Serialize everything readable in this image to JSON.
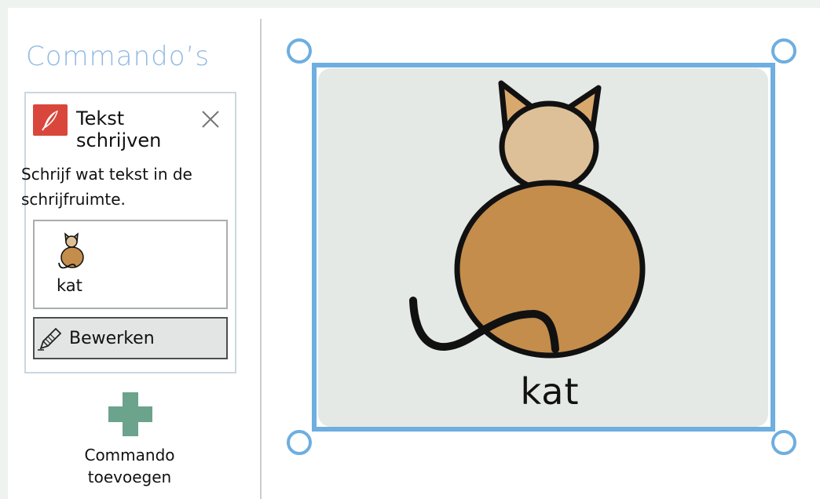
{
  "panel": {
    "title": "Commando’s"
  },
  "command": {
    "icon": "quill-icon",
    "title": "Tekst schrijven",
    "description": "Schrijf wat tekst in de schrijfruimte.",
    "symbol_label": "kat",
    "edit_label": "Bewerken"
  },
  "add_command": {
    "label": "Commando toevoegen",
    "icon": "plus-icon"
  },
  "canvas": {
    "card_label": "kat",
    "symbol_icon": "cat-icon"
  },
  "colors": {
    "accent_blue": "#6eaee0",
    "title_blue": "#93b9e3",
    "command_red": "#d9473c",
    "plus_green": "#6ba38c",
    "cat_body": "#c48d4c",
    "cat_head": "#ddc098"
  }
}
